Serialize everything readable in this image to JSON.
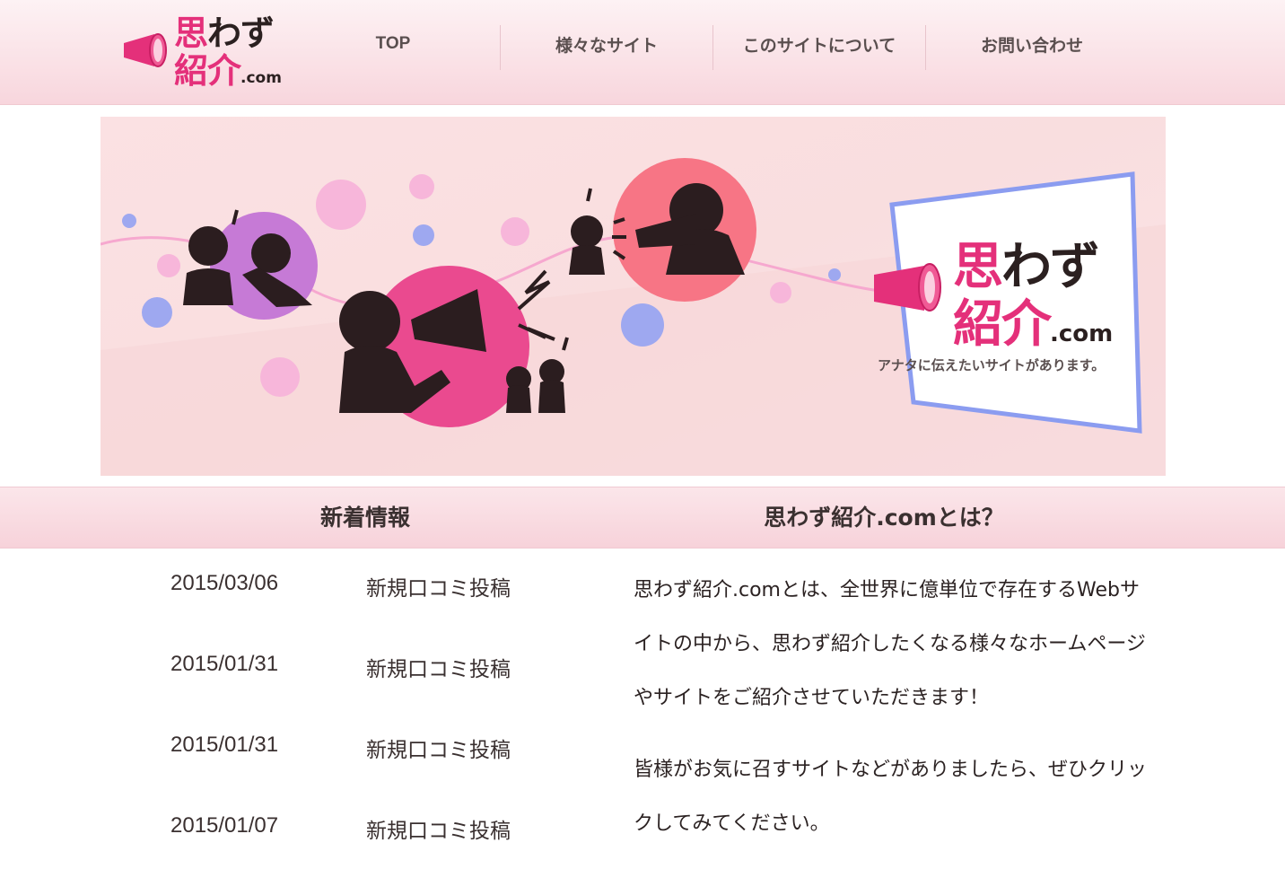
{
  "header": {
    "logo": {
      "line1_main": "思",
      "line1_accent": "わず",
      "line2_main": "紹介",
      "line2_suffix": ".com"
    },
    "nav": [
      {
        "label": "TOP"
      },
      {
        "label": "様々なサイト"
      },
      {
        "label": "このサイトについて"
      },
      {
        "label": "お問い合わせ"
      }
    ]
  },
  "hero": {
    "logo_line1_main": "思",
    "logo_line1_accent": "わず",
    "logo_line2_main": "紹介",
    "logo_line2_suffix": ".com",
    "tagline": "アナタに伝えたいサイトがあります。"
  },
  "sections": {
    "news_heading": "新着情報",
    "about_heading": "思わず紹介.comとは？"
  },
  "news": [
    {
      "date": "2015/03/06",
      "title": "新規口コミ投稿"
    },
    {
      "date": "2015/01/31",
      "title": "新規口コミ投稿"
    },
    {
      "date": "2015/01/31",
      "title": "新規口コミ投稿"
    },
    {
      "date": "2015/01/07",
      "title": "新規口コミ投稿"
    }
  ],
  "about": {
    "p1": "思わず紹介.comとは、全世界に億単位で存在するWebサイトの中から、思わず紹介したくなる様々なホームページやサイトをご紹介させていただきます！",
    "p2": "皆様がお気に召すサイトなどがありましたら、ぜひクリックしてみてください。"
  },
  "colors": {
    "accent": "#e4307a",
    "header_bg": "#f8d6dd",
    "band_bg": "#f7d2da"
  }
}
